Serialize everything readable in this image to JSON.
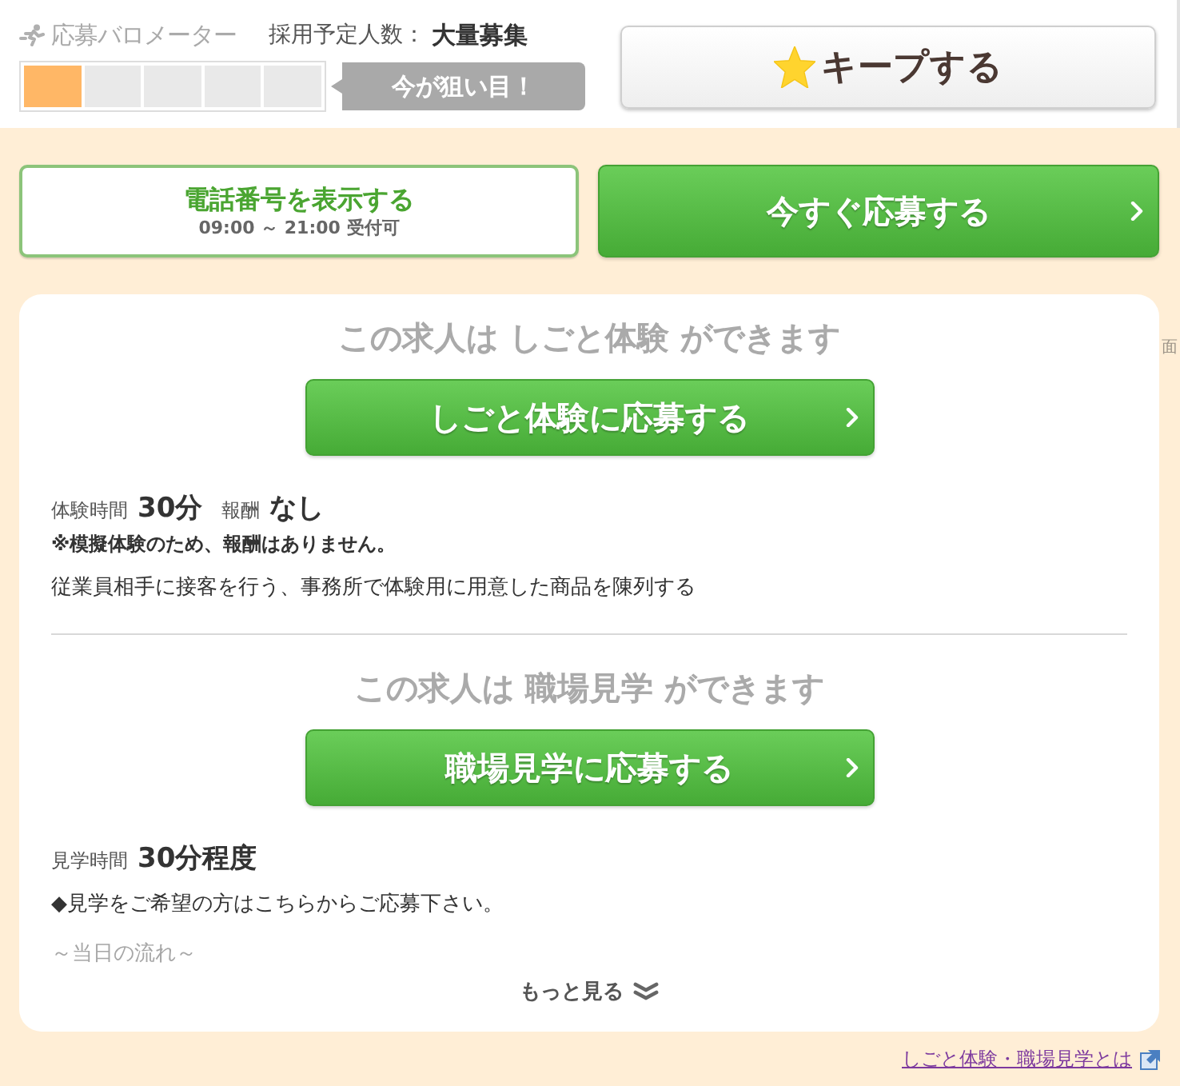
{
  "barometer": {
    "label": "応募バロメーター",
    "level": 0.2,
    "badge": "今が狙い目！"
  },
  "hiring": {
    "label": "採用予定人数：",
    "value": "大量募集"
  },
  "keep_button": {
    "label": "キープする"
  },
  "phone_button": {
    "label": "電話番号を表示する",
    "hours": "09:00 ～ 21:00 受付可"
  },
  "apply_button": {
    "label": "今すぐ応募する"
  },
  "sections": [
    {
      "heading": "この求人は しごと体験 ができます",
      "button": "しごと体験に応募する",
      "details": [
        {
          "label": "体験時間",
          "value": "30分"
        },
        {
          "label": "報酬",
          "value": "なし"
        }
      ],
      "note": "※模擬体験のため、報酬はありません。",
      "lines": [
        {
          "text": "従業員相手に接客を行う、事務所で体験用に用意した商品を陳列する",
          "faded": false
        }
      ]
    },
    {
      "heading": "この求人は 職場見学 ができます",
      "button": "職場見学に応募する",
      "details": [
        {
          "label": "見学時間",
          "value": "30分程度"
        }
      ],
      "lines": [
        {
          "text": "◆見学をご希望の方はこちらからご応募下さい。",
          "faded": false
        },
        {
          "text": "～当日の流れ～",
          "faded": true
        }
      ]
    }
  ],
  "more_button": "もっと見る",
  "edge_fragment": "面",
  "footer_link": "しごと体験・職場見学とは"
}
